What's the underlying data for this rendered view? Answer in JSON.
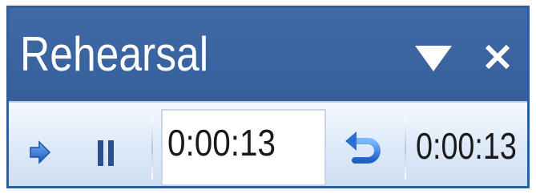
{
  "window": {
    "title": "Rehearsal"
  },
  "titlebar": {
    "options_icon": "triangle-down-icon",
    "close_icon": "close-icon"
  },
  "controls": {
    "next_icon": "next-arrow-icon",
    "pause_icon": "pause-icon",
    "slide_time": "0:00:13",
    "repeat_icon": "repeat-icon",
    "total_time": "0:00:13"
  },
  "colors": {
    "titlebar": "#3a64a0",
    "toolbar_bg": "#dde9f8",
    "accent_blue": "#2f6fd0"
  }
}
